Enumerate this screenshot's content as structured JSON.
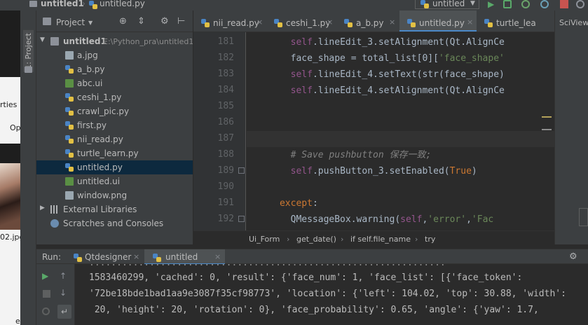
{
  "navbar": {
    "project": "untitled1",
    "file": "untitled.py",
    "run_config": "untitled"
  },
  "left_strip": {
    "project_tool": "1: Project"
  },
  "desktop": {
    "text1": "rties",
    "text2": "Op",
    "text3": "02.jpg",
    "text4": "e"
  },
  "project_panel": {
    "title": "Project",
    "root": {
      "name": "untitled1",
      "path": "E:\\Python_pra\\untitled1"
    },
    "files": [
      {
        "name": "a.jpg",
        "kind": "img"
      },
      {
        "name": "a_b.py",
        "kind": "py"
      },
      {
        "name": "abc.ui",
        "kind": "ui"
      },
      {
        "name": "ceshi_1.py",
        "kind": "py"
      },
      {
        "name": "crawl_pic.py",
        "kind": "py"
      },
      {
        "name": "first.py",
        "kind": "py"
      },
      {
        "name": "nii_read.py",
        "kind": "py"
      },
      {
        "name": "turtle_learn.py",
        "kind": "py"
      },
      {
        "name": "untitled.py",
        "kind": "py",
        "selected": true
      },
      {
        "name": "untitled.ui",
        "kind": "ui"
      },
      {
        "name": "window.png",
        "kind": "img"
      }
    ],
    "external_libraries": "External Libraries",
    "scratches": "Scratches and Consoles"
  },
  "tabs": [
    {
      "label": "nii_read.py",
      "active": false
    },
    {
      "label": "ceshi_1.py",
      "active": false
    },
    {
      "label": "a_b.py",
      "active": false
    },
    {
      "label": "untitled.py",
      "active": true
    },
    {
      "label": "turtle_lea",
      "active": false
    }
  ],
  "sciview": "SciView:",
  "editor": {
    "current_line": 187,
    "lines": [
      {
        "n": "181",
        "code": "    self.lineEdit_3.setAlignment(Qt.AlignCe"
      },
      {
        "n": "182",
        "code": "    face_shape = total_list[0]['face_shape'"
      },
      {
        "n": "183",
        "code": "    self.lineEdit_4.setText(str(face_shape)"
      },
      {
        "n": "184",
        "code": "    self.lineEdit_4.setAlignment(Qt.AlignCe"
      },
      {
        "n": "185",
        "code": ""
      },
      {
        "n": "186",
        "code": ""
      },
      {
        "n": "187",
        "code": ""
      },
      {
        "n": "188",
        "code": "    # Save pushbutton 保存一致;"
      },
      {
        "n": "189",
        "code": "    self.pushButton_3.setEnabled(True)"
      },
      {
        "n": "190",
        "code": ""
      },
      {
        "n": "191",
        "code": "except:"
      },
      {
        "n": "192",
        "code": "    QMessageBox.warning(self,'error','Fac"
      }
    ]
  },
  "breadcrumbs": [
    "Ui_Form",
    "get_date()",
    "if self.file_name",
    "try"
  ],
  "run_panel": {
    "label": "Run:",
    "tabs": [
      "Qtdesigner",
      "untitled"
    ],
    "active_tab": "untitled",
    "output": [
      "1583460299, 'cached': 0, 'result': {'face_num': 1, 'face_list': [{'face_token':",
      "'72be18bde1bad1aa9e3087f35cf98773', 'location': {'left': 104.02, 'top': 30.88, 'width':",
      " 20, 'height': 20, 'rotation': 0}, 'face_probability': 0.65, 'angle': {'yaw': 1.7,"
    ]
  },
  "colors": {
    "bg": "#2b2b2b",
    "panel": "#3c3f41",
    "selection": "#0d293e",
    "accent": "#4a88c7",
    "keyword": "#cc7832",
    "self": "#94558d",
    "string": "#6a8759",
    "comment": "#808080"
  }
}
